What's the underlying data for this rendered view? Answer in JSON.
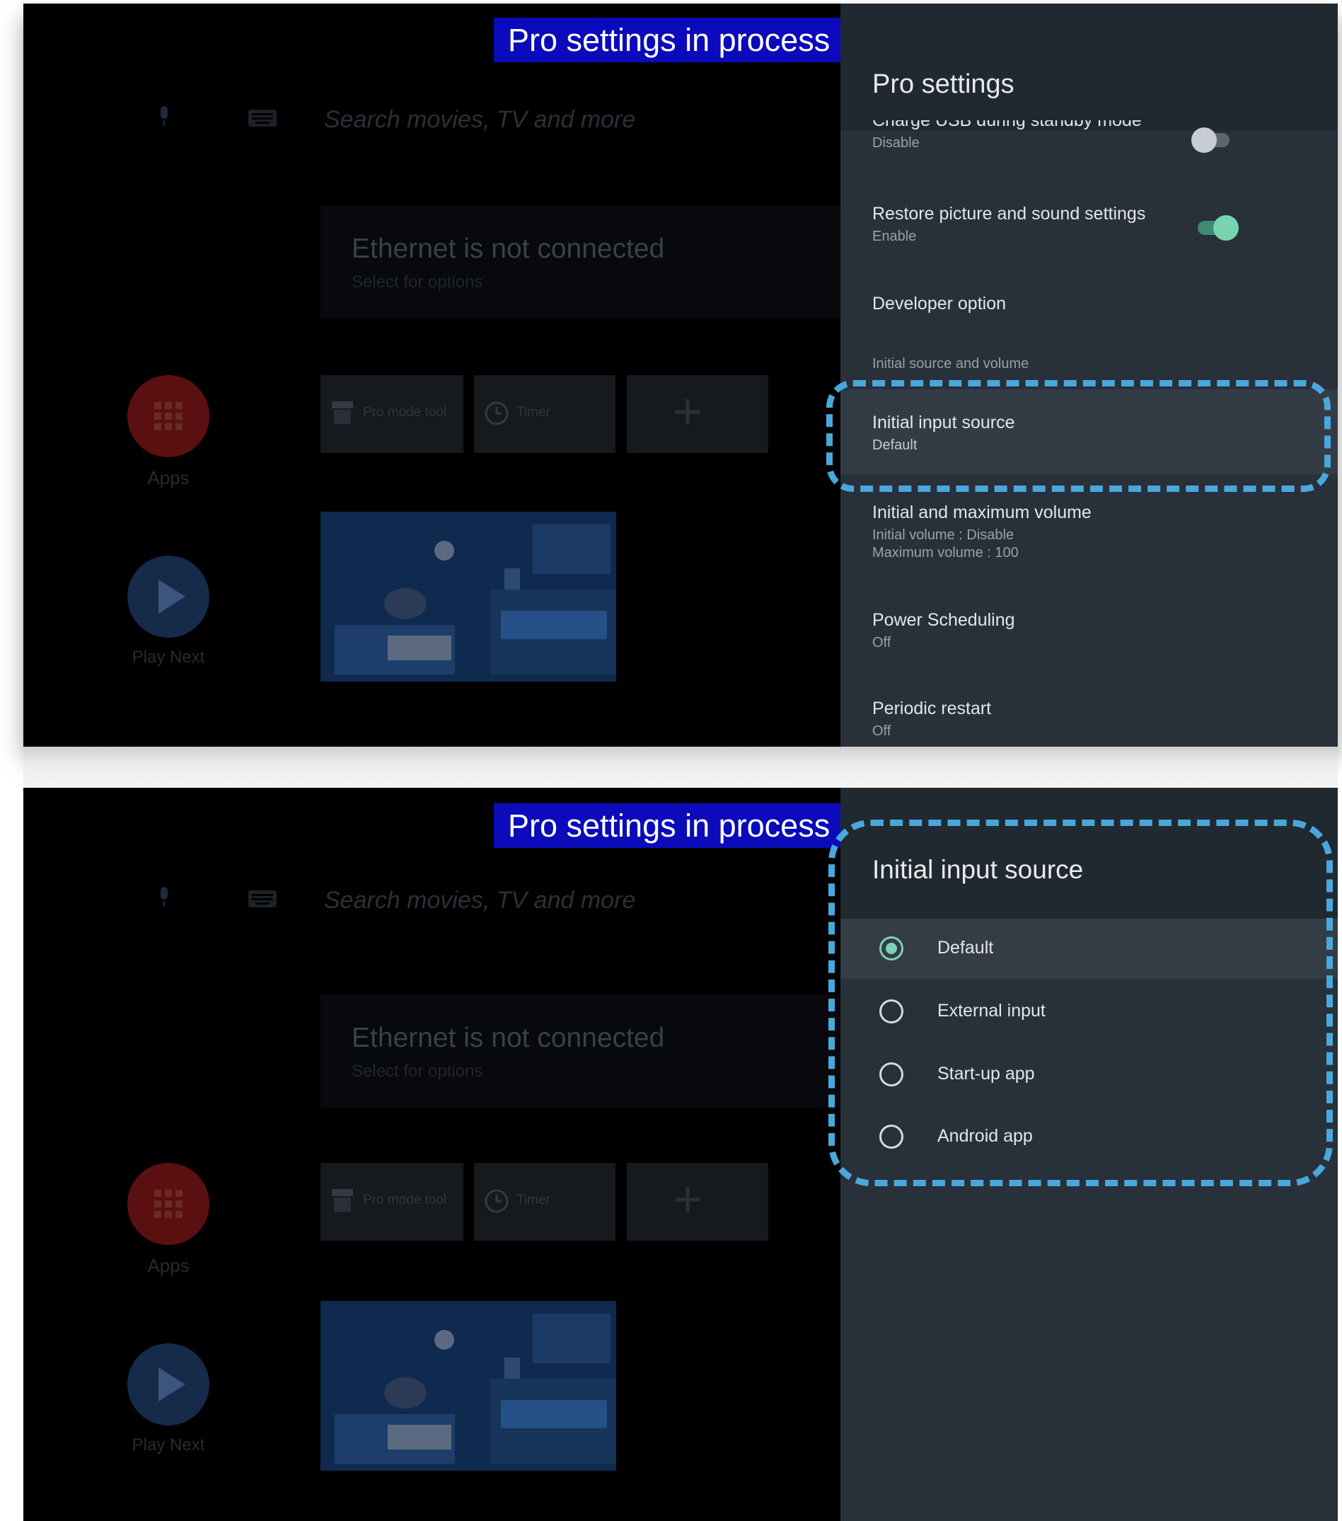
{
  "overlay_label": "Pro settings in process",
  "home": {
    "search_placeholder": "Search movies, TV and more",
    "network_title": "Ethernet is not connected",
    "network_subtitle": "Select for options",
    "apps_label": "Apps",
    "play_next_label": "Play Next",
    "tiles": [
      "Pro mode tool",
      "Timer"
    ]
  },
  "pro_settings": {
    "title": "Pro settings",
    "items": [
      {
        "title": "Charge USB during standby mode",
        "subtitle": "Disable",
        "toggle": "off"
      },
      {
        "title": "Restore picture and sound settings",
        "subtitle": "Enable",
        "toggle": "on"
      },
      {
        "title": "Developer option"
      }
    ],
    "category": "Initial source and volume",
    "selected_item": {
      "title": "Initial input source",
      "subtitle": "Default"
    },
    "more_items": [
      {
        "title": "Initial and maximum volume",
        "subtitle": "Initial volume : Disable",
        "subtitle2": "Maximum volume : 100"
      },
      {
        "title": "Power Scheduling",
        "subtitle": "Off"
      },
      {
        "title": "Periodic restart",
        "subtitle": "Off"
      }
    ]
  },
  "input_source": {
    "title": "Initial input source",
    "options": [
      "Default",
      "External input",
      "Start-up app",
      "Android app"
    ],
    "selected": "Default"
  },
  "colors": {
    "accent": "#7ad3b0",
    "highlight_dash": "#4aa7dc",
    "overlay_bg": "#0b0bbb",
    "panel_bg": "#283039"
  }
}
